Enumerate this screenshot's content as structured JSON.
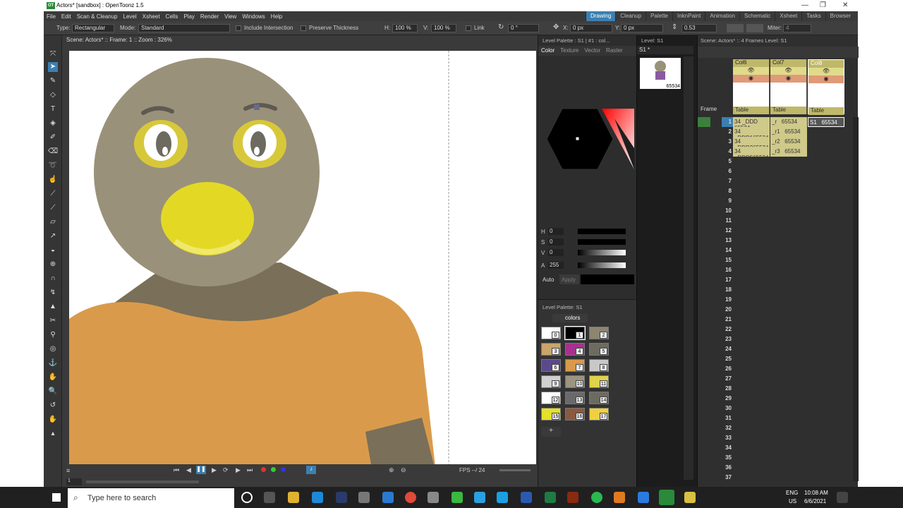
{
  "window": {
    "title": "Actors* [sandbox] : OpenToonz 1.5",
    "controls": [
      "—",
      "❐",
      "✕"
    ]
  },
  "menu": [
    "File",
    "Edit",
    "Scan & Cleanup",
    "Level",
    "Xsheet",
    "Cells",
    "Play",
    "Render",
    "View",
    "Windows",
    "Help"
  ],
  "rooms": [
    {
      "label": "Drawing",
      "active": true
    },
    {
      "label": "Cleanup"
    },
    {
      "label": "Palette"
    },
    {
      "label": "InknPaint"
    },
    {
      "label": "Animation"
    },
    {
      "label": "Schematic"
    },
    {
      "label": "Xsheet"
    },
    {
      "label": "Tasks"
    },
    {
      "label": "Browser"
    }
  ],
  "tool_options": {
    "type_label": "Type:",
    "type_value": "Rectangular",
    "mode_label": "Mode:",
    "mode_value": "Standard",
    "include_intersection": "Include Intersection",
    "preserve_thickness": "Preserve Thickness",
    "h_label": "H:",
    "h_value": "100 %",
    "v_label": "V:",
    "v_value": "100 %",
    "link": "Link",
    "rot_value": "0 °",
    "x_label": "X:",
    "x_value": "0 px",
    "y_label": "Y:",
    "y_value": "0 px",
    "thick_value": "0.53",
    "miter_label": "Miter:",
    "miter_value": "4"
  },
  "viewer": {
    "header": "Scene: Actors*  ::  Frame: 1  ::  Zoom : 326%",
    "fps_label": "FPS --/ 24",
    "frame_field": "1"
  },
  "style_editor": {
    "header": "Level Palette : S1 | #1 : col...",
    "tabs": [
      "Color",
      "Texture",
      "Vector",
      "Raster"
    ],
    "channels": [
      {
        "k": "H",
        "v": "0"
      },
      {
        "k": "S",
        "v": "0"
      },
      {
        "k": "V",
        "v": "0"
      },
      {
        "k": "A",
        "v": "255"
      }
    ],
    "auto": "Auto",
    "apply": "Apply"
  },
  "level_palette": {
    "header": "Level Palette: S1",
    "page_tab": "colors",
    "swatches": [
      {
        "n": "0",
        "c": "#ffffff"
      },
      {
        "n": "1",
        "c": "#000000"
      },
      {
        "n": "2",
        "c": "#8c8570"
      },
      {
        "n": "3",
        "c": "#c9a56b"
      },
      {
        "n": "4",
        "c": "#a8308f"
      },
      {
        "n": "5",
        "c": "#6d6a60"
      },
      {
        "n": "6",
        "c": "#5a4a8c"
      },
      {
        "n": "7",
        "c": "#d89a4a"
      },
      {
        "n": "8",
        "c": "#c8c8c8"
      },
      {
        "n": "9",
        "c": "#d0d0d0"
      },
      {
        "n": "10",
        "c": "#9b9480"
      },
      {
        "n": "11",
        "c": "#e0d24a"
      },
      {
        "n": "12",
        "c": "#ffffff"
      },
      {
        "n": "13",
        "c": "#6a6a6a"
      },
      {
        "n": "14",
        "c": "#6d6a60"
      },
      {
        "n": "15",
        "c": "#e5e02a"
      },
      {
        "n": "16",
        "c": "#8a5a40"
      },
      {
        "n": "17",
        "c": "#f0d040"
      }
    ]
  },
  "level_strip": {
    "header": "Level:  S1",
    "level_name": "S1 *",
    "frame_label": "65534"
  },
  "xsheet": {
    "header": "Scene: Actors*  ::  4 Frames  Level: S1",
    "frame_label": "Frame",
    "columns": [
      {
        "name": "Col6",
        "level": "Table"
      },
      {
        "name": "Col7",
        "level": "Table"
      },
      {
        "name": "Col8",
        "level": "Table"
      }
    ],
    "cells": [
      [
        "34",
        "_DDD",
        "65534",
        "_r",
        "65534",
        "S1",
        "65534"
      ],
      [
        "34",
        "_DDD165534",
        "",
        "_r1",
        "65534",
        "",
        ""
      ],
      [
        "34",
        "_DDD365534",
        "",
        "_r2",
        "65534",
        "",
        ""
      ],
      [
        "34",
        "_DDD565534",
        "",
        "_r3",
        "65534",
        "",
        ""
      ]
    ],
    "frames": [
      "1",
      "2",
      "3",
      "4",
      "5",
      "6",
      "7",
      "8",
      "9",
      "10",
      "11",
      "12",
      "13",
      "14",
      "15",
      "16",
      "17",
      "18",
      "19",
      "20",
      "21",
      "22",
      "23",
      "24",
      "25",
      "26",
      "27",
      "28",
      "29",
      "30",
      "31",
      "32",
      "33",
      "34",
      "35",
      "36",
      "37"
    ]
  },
  "taskbar": {
    "search_placeholder": "Type here to search",
    "lang1": "ENG",
    "lang2": "US",
    "time": "10:08 AM",
    "date": "6/6/2021"
  },
  "colors": {
    "accent": "#3c7fb1",
    "canvas": "#ffffff"
  }
}
